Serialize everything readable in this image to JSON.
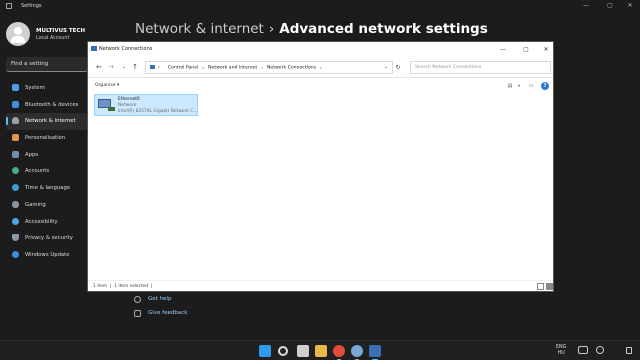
{
  "settings": {
    "window_title": "Settings",
    "user": {
      "name": "MULTIVUS TECH",
      "account": "Local Account"
    },
    "search_placeholder": "Find a setting",
    "nav": [
      {
        "label": "System",
        "icon": "monitor-icon",
        "color": "#4c9cf0"
      },
      {
        "label": "Bluetooth & devices",
        "icon": "bluetooth-icon",
        "color": "#3f8ee0"
      },
      {
        "label": "Network & internet",
        "icon": "wifi-icon",
        "color": "#9aa3ad",
        "active": true
      },
      {
        "label": "Personalisation",
        "icon": "brush-icon",
        "color": "#e0964b"
      },
      {
        "label": "Apps",
        "icon": "apps-icon",
        "color": "#6f8fb0"
      },
      {
        "label": "Accounts",
        "icon": "person-icon",
        "color": "#3fb08a"
      },
      {
        "label": "Time & language",
        "icon": "globe-clock-icon",
        "color": "#3b9ad9"
      },
      {
        "label": "Gaming",
        "icon": "gamepad-icon",
        "color": "#8a96a3"
      },
      {
        "label": "Accessibility",
        "icon": "accessibility-icon",
        "color": "#4aa6e8"
      },
      {
        "label": "Privacy & security",
        "icon": "shield-icon",
        "color": "#8a96a3"
      },
      {
        "label": "Windows Update",
        "icon": "update-icon",
        "color": "#3b8ee0"
      }
    ],
    "breadcrumb": {
      "parent": "Network & internet",
      "separator": "›",
      "current": "Advanced network settings"
    },
    "help_links": {
      "get_help": "Get help",
      "give_feedback": "Give feedback"
    }
  },
  "explorer": {
    "title": "Network Connections",
    "address": {
      "segments": [
        "Control Panel",
        "Network and Internet",
        "Network Connections"
      ],
      "separator": "›"
    },
    "search_placeholder": "Search Network Connections",
    "toolbar": {
      "organise": "Organise ▾"
    },
    "items": [
      {
        "name": "Ethernet0",
        "status": "Network",
        "device": "Intel(R) 82574L Gigabit Network C..."
      }
    ],
    "status": {
      "count": "1 item",
      "selected": "1 item selected"
    }
  },
  "taskbar": {
    "lang_top": "ENG",
    "lang_bottom": "HU"
  },
  "colors": {
    "accent": "#4cc2ff",
    "selection": "#cce8ff"
  }
}
